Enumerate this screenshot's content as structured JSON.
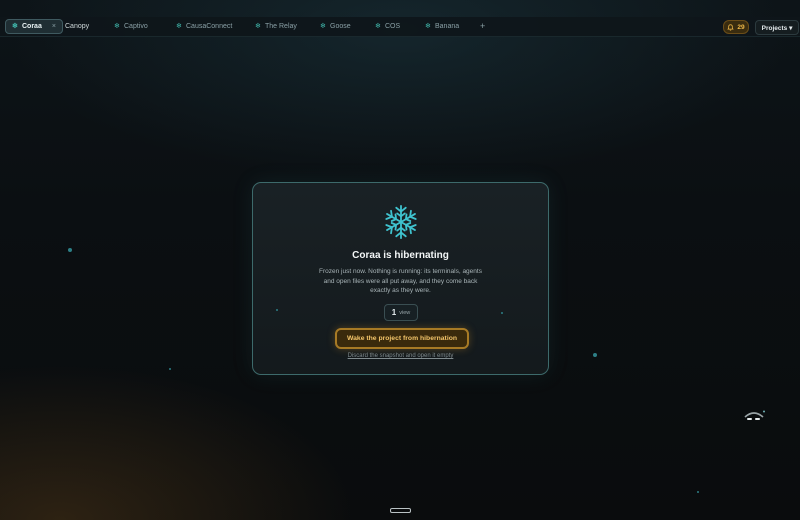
{
  "tabs": [
    {
      "label": "Coraa",
      "active": true,
      "has_icon": true
    },
    {
      "label": "Canopy",
      "active": false,
      "has_icon": false
    },
    {
      "label": "Captivo",
      "active": false,
      "has_icon": true
    },
    {
      "label": "CausaConnect",
      "active": false,
      "has_icon": true
    },
    {
      "label": "The Relay",
      "active": false,
      "has_icon": true
    },
    {
      "label": "Goose",
      "active": false,
      "has_icon": true
    },
    {
      "label": "COS",
      "active": false,
      "has_icon": true
    },
    {
      "label": "Banana",
      "active": false,
      "has_icon": true
    }
  ],
  "add_tab_label": "+",
  "close_tab_label": "×",
  "notifications": {
    "count": "29",
    "icon": "bell-icon"
  },
  "projects_button": {
    "label": "Projects ▾"
  },
  "hibernation": {
    "icon": "snowflake-icon",
    "title": "Coraa is hibernating",
    "description": "Frozen just now. Nothing is running: its terminals, agents and open files were all put away, and they come back exactly as they were.",
    "view_count": "1",
    "view_label": "view",
    "wake_label": "Wake the project from hibernation",
    "discard_label": "Discard the snapshot and open it empty"
  },
  "colors": {
    "accent_teal": "#3fb3a8",
    "wake_amber": "#f3c56a",
    "card_border": "#3d6a6b"
  }
}
